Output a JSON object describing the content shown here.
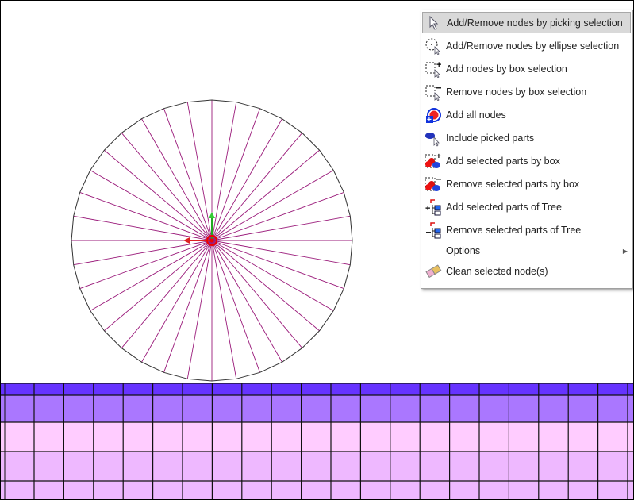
{
  "menu": {
    "items": [
      {
        "label": "Add/Remove nodes by picking selection",
        "icon": "cursor-arrow-icon",
        "highlighted": true
      },
      {
        "label": "Add/Remove nodes by ellipse selection",
        "icon": "ellipse-select-icon"
      },
      {
        "label": "Add nodes by box selection",
        "icon": "box-select-add-icon"
      },
      {
        "label": "Remove nodes by box selection",
        "icon": "box-select-remove-icon"
      },
      {
        "label": "Add all nodes",
        "icon": "add-all-nodes-icon"
      },
      {
        "label": "Include picked parts",
        "icon": "pick-part-icon"
      },
      {
        "label": "Add selected parts by box",
        "icon": "parts-box-add-icon"
      },
      {
        "label": "Remove selected parts by box",
        "icon": "parts-box-remove-icon"
      },
      {
        "label": "Add selected parts of Tree",
        "icon": "tree-add-icon"
      },
      {
        "label": "Remove selected parts of Tree",
        "icon": "tree-remove-icon"
      },
      {
        "label": "Options",
        "icon": "",
        "submenu": true
      },
      {
        "label": "Clean selected node(s)",
        "icon": "eraser-icon"
      }
    ]
  },
  "colors": {
    "mesh_top": "#6633ff",
    "mesh_row2": "#aa77ff",
    "mesh_row3": "#ffccff",
    "mesh_row4": "#eeb8ff",
    "spokes": "#9a1a7a"
  }
}
